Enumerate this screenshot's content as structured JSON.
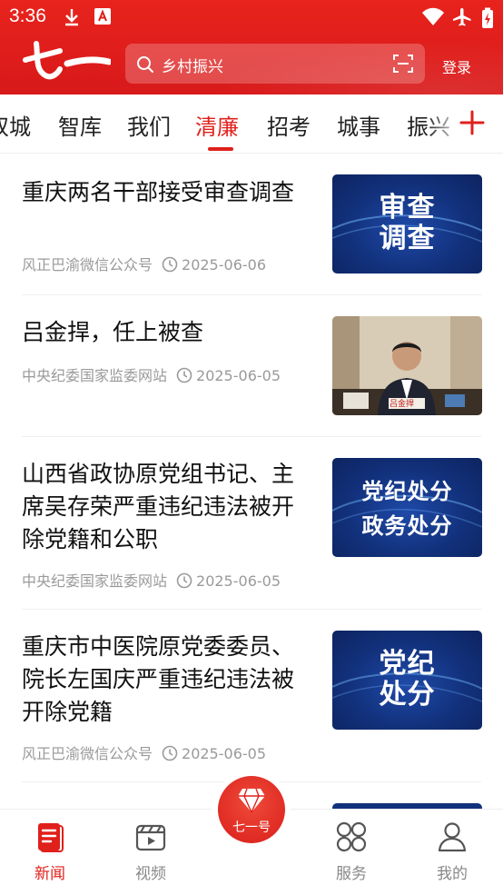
{
  "status_bar": {
    "time": "3:36"
  },
  "header": {
    "logo_text": "七一",
    "search_placeholder": "乡村振兴",
    "login_label": "登录"
  },
  "tabs": [
    "双城",
    "智库",
    "我们",
    "清廉",
    "招考",
    "城事",
    "振兴"
  ],
  "active_tab": "清廉",
  "news": [
    {
      "title": "重庆两名干部接受审查调查",
      "source": "风正巴渝微信公众号",
      "date": "2025-06-06",
      "thumb_text": "审查\n调查"
    },
    {
      "title": "吕金捍，任上被查",
      "source": "中央纪委国家监委网站",
      "date": "2025-06-05",
      "thumb_text": "吕金捍"
    },
    {
      "title": "山西省政协原党组书记、主席吴存荣严重违纪违法被开除党籍和公职",
      "source": "中央纪委国家监委网站",
      "date": "2025-06-05",
      "thumb_text": "党纪处分\n政务处分"
    },
    {
      "title": "重庆市中医院原党委委员、院长左国庆严重违纪违法被开除党籍",
      "source": "风正巴渝微信公众号",
      "date": "2025-06-05",
      "thumb_text": "党纪\n处分"
    }
  ],
  "tabbar": [
    {
      "label": "新闻",
      "active": true
    },
    {
      "label": "视频",
      "active": false
    },
    {
      "label": "七一号",
      "active": false
    },
    {
      "label": "服务",
      "active": false
    },
    {
      "label": "我的",
      "active": false
    }
  ],
  "colors": {
    "brand_red": "#e0201b",
    "thumb_blue": "#12317c"
  }
}
